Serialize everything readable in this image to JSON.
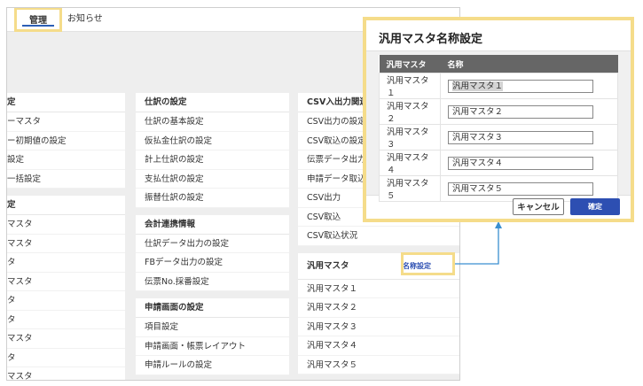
{
  "tabs": {
    "kanri": "管理",
    "oshirase": "お知らせ"
  },
  "col1": {
    "sec1": {
      "title": "定",
      "items": [
        "ーマスタ",
        "ー初期値の設定",
        "設定",
        "一括設定"
      ]
    },
    "sec2": {
      "title": "定",
      "items": [
        "マスタ",
        "マスタ",
        "タ",
        "マスタ",
        "タ",
        "タ",
        "マスタ",
        "タ",
        "マスタ"
      ]
    }
  },
  "col2": {
    "sec1": {
      "title": "仕訳の設定",
      "items": [
        "仕訳の基本設定",
        "仮払金仕訳の設定",
        "計上仕訳の設定",
        "支払仕訳の設定",
        "振替仕訳の設定"
      ]
    },
    "sec2": {
      "title": "会計連携情報",
      "items": [
        "仕訳データ出力の設定",
        "FBデータ出力の設定",
        "伝票No.採番設定"
      ]
    },
    "sec3": {
      "title": "申請画面の設定",
      "items": [
        "項目設定",
        "申請画面・帳票レイアウト",
        "申請ルールの設定"
      ]
    }
  },
  "col3": {
    "sec1": {
      "title": "CSV入出力関連",
      "items": [
        "CSV出力の設定",
        "CSV取込の設定",
        "伝票データ出力の",
        "申請データ取込の",
        "CSV出力",
        "CSV取込",
        "CSV取込状況"
      ]
    },
    "sec2": {
      "title": "汎用マスタ",
      "link": "名称設定",
      "items": [
        "汎用マスタ１",
        "汎用マスタ２",
        "汎用マスタ３",
        "汎用マスタ４",
        "汎用マスタ５"
      ]
    }
  },
  "modal": {
    "title": "汎用マスタ名称設定",
    "headers": [
      "汎用マスタ",
      "名称"
    ],
    "rows": [
      {
        "label": "汎用マスタ１",
        "value": "汎用マスタ１"
      },
      {
        "label": "汎用マスタ２",
        "value": "汎用マスタ２"
      },
      {
        "label": "汎用マスタ３",
        "value": "汎用マスタ３"
      },
      {
        "label": "汎用マスタ４",
        "value": "汎用マスタ４"
      },
      {
        "label": "汎用マスタ５",
        "value": "汎用マスタ５"
      }
    ],
    "cancel": "キャンセル",
    "ok": "確定"
  },
  "colors": {
    "highlight": "#f5dc8a",
    "accent": "#2d4fb2",
    "connector": "#3a8fd0"
  }
}
